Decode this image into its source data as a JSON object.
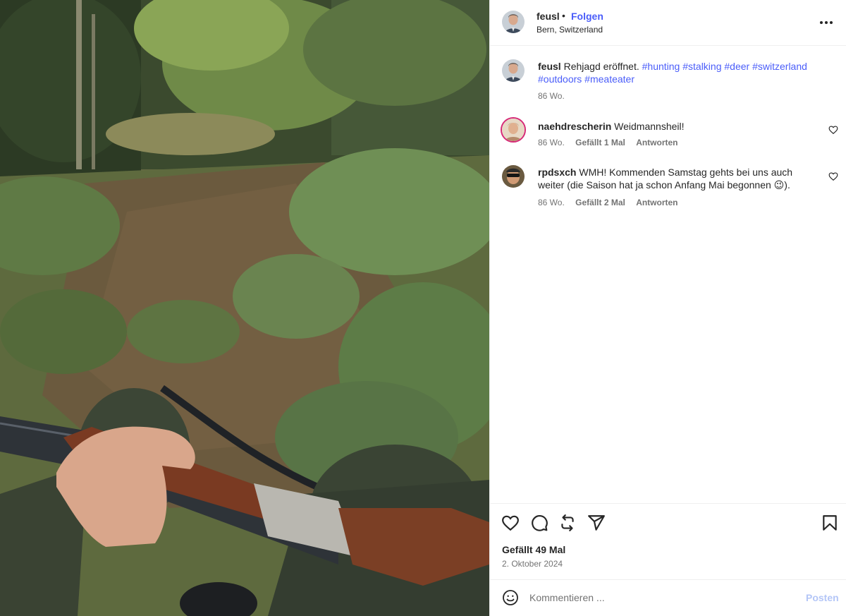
{
  "post": {
    "author": "feusl",
    "dot": "•",
    "follow_label": "Folgen",
    "location": "Bern, Switzerland",
    "caption": {
      "user": "feusl",
      "text": "Rehjagd eröffnet.",
      "hashtags": [
        "#hunting",
        "#stalking",
        "#deer",
        "#switzerland",
        "#outdoors",
        "#meateater"
      ],
      "time": "86 Wo."
    },
    "comments": [
      {
        "user": "naehdrescherin",
        "text": "Weidmannsheil!",
        "time": "86 Wo.",
        "likes": "Gefällt 1 Mal",
        "reply": "Antworten"
      },
      {
        "user": "rpdsxch",
        "text_line1": "WMH! Kommenden Samstag gehts bei uns auch",
        "text_line2": "weiter (die Saison hat ja schon Anfang Mai begonnen",
        "emoji": "😉",
        "text_end": ").",
        "time": "86 Wo.",
        "likes": "Gefällt 2 Mal",
        "reply": "Antworten"
      }
    ],
    "like_count": "Gefällt 49 Mal",
    "date": "2. Oktober 2024",
    "comment_placeholder": "Kommentieren ...",
    "post_label": "Posten"
  },
  "icons": {
    "more": "more-options-icon",
    "like": "heart-icon",
    "comment": "comment-icon",
    "repost": "repost-icon",
    "share": "share-icon",
    "save": "bookmark-icon",
    "emoji": "emoji-icon"
  },
  "colors": {
    "link": "#4a5df9",
    "muted": "#737373",
    "post_disabled": "#b4c6f7",
    "text": "#262626"
  }
}
